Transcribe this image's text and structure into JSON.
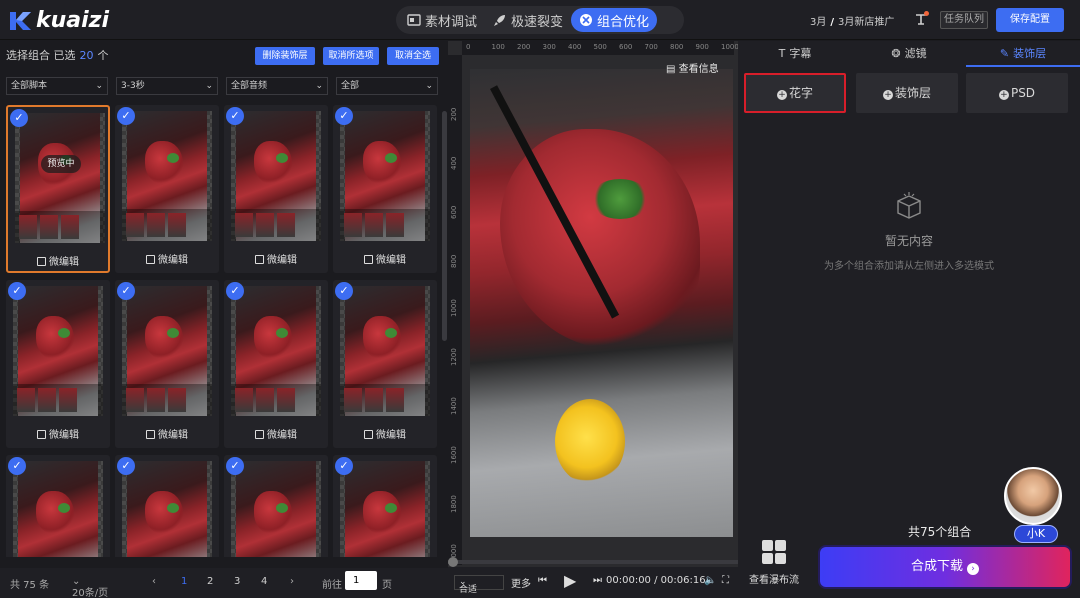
{
  "header": {
    "logo_text": "kuaizi",
    "tabs": [
      {
        "label": "素材调试",
        "icon": "material-icon"
      },
      {
        "label": "极速裂变",
        "icon": "rocket-icon"
      },
      {
        "label": "组合优化",
        "icon": "combine-icon",
        "active": true
      }
    ],
    "breadcrumb": {
      "month": "3月",
      "sep": "/",
      "project": "3月新店推广"
    },
    "queue_label": "任务队列",
    "save_label": "保存配置"
  },
  "left": {
    "select_label": "选择组合 已选",
    "selected_count": "20",
    "unit": "个",
    "buttons": {
      "remove_deco": "删除装饰层",
      "cancel_selected": "取消所选项",
      "cancel_all": "取消全选"
    },
    "filters": [
      "全部脚本",
      "3-3秒",
      "全部音频",
      "全部"
    ],
    "card_edit_label": "微编辑",
    "preview_label": "预览中",
    "pager": {
      "total": "共 75 条",
      "per_page": "20条/页",
      "pages": [
        "1",
        "2",
        "3",
        "4"
      ],
      "current": "1",
      "goto_label": "前往",
      "goto_value": "1",
      "page_unit": "页"
    }
  },
  "center": {
    "ruler_top": [
      "0",
      "100",
      "200",
      "300",
      "400",
      "500",
      "600",
      "700",
      "800",
      "900",
      "1000"
    ],
    "ruler_left": [
      "200",
      "400",
      "600",
      "800",
      "1000",
      "1200",
      "1400",
      "1600",
      "1800",
      "2000"
    ],
    "view_info": "查看信息",
    "fit_label": "合适",
    "more_label": "更多",
    "time": "00:00:00 / 00:06:16"
  },
  "right": {
    "tabs": [
      {
        "label": "字幕",
        "icon": "text-icon"
      },
      {
        "label": "滤镜",
        "icon": "filter-icon"
      },
      {
        "label": "装饰层",
        "icon": "brush-icon",
        "active": true
      }
    ],
    "options": [
      "花字",
      "装饰层",
      "PSD"
    ],
    "empty_title": "暂无内容",
    "empty_sub": "为多个组合添加请从左侧进入多选模式",
    "total_label": "共75个组合",
    "assistant_name": "小K",
    "waterfall_label": "查看瀑布流",
    "generate_label": "合成下载"
  },
  "colors": {
    "accent": "#3d6df2",
    "highlight": "#d81e2a",
    "selected_card": "#e07a2c"
  }
}
